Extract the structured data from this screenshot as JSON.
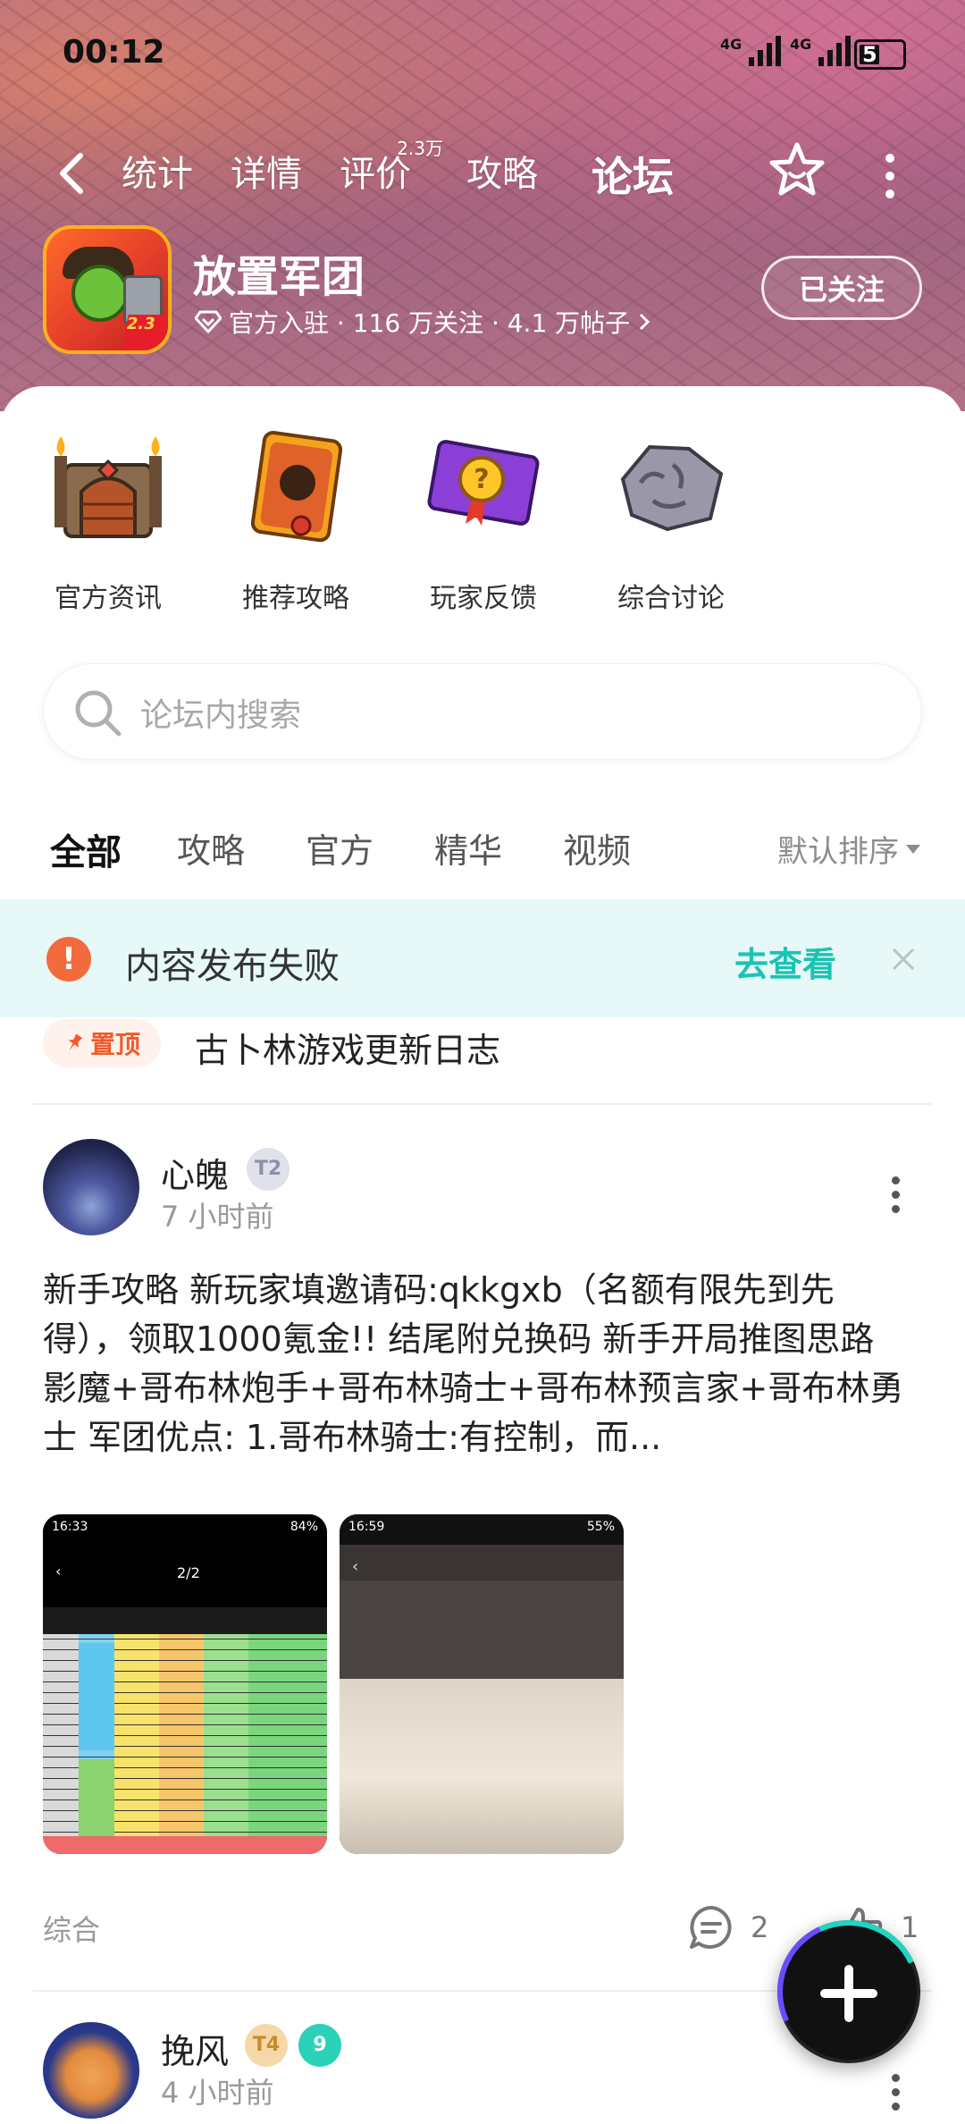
{
  "status": {
    "time": "00:12",
    "sig1": "4G",
    "sig2": "4G",
    "battery": "5"
  },
  "nav": {
    "tabs": [
      {
        "label": "统计"
      },
      {
        "label": "详情"
      },
      {
        "label": "评价",
        "sup": "2.3万"
      },
      {
        "label": "攻略"
      },
      {
        "label": "论坛"
      }
    ]
  },
  "game": {
    "name": "放置军团",
    "meta": "官方入驻 · 116 万关注 · 4.1 万帖子",
    "icon_badge": "2.3",
    "follow_label": "已关注"
  },
  "categories": [
    {
      "label": "官方资讯",
      "icon": "castle-gate-icon"
    },
    {
      "label": "推荐攻略",
      "icon": "guide-book-icon"
    },
    {
      "label": "玩家反馈",
      "icon": "feedback-book-icon"
    },
    {
      "label": "综合讨论",
      "icon": "stone-tablet-icon"
    }
  ],
  "search": {
    "placeholder": "论坛内搜索"
  },
  "filter": {
    "tabs": [
      "全部",
      "攻略",
      "官方",
      "精华",
      "视频"
    ],
    "sort": "默认排序"
  },
  "banner": {
    "message": "内容发布失败",
    "action": "去查看"
  },
  "pinned": {
    "badge": "置顶",
    "title": "古卜林游戏更新日志"
  },
  "post1": {
    "user": "心魄",
    "level": "T2",
    "time": "7 小时前",
    "body": "新手攻略  新玩家填邀请码:qkkgxb（名额有限先到先得），领取1000氪金!!  结尾附兑换码  新手开局推图思路  影魔+哥布林炮手+哥布林骑士+哥布林预言家+哥布林勇士  军团优点: 1.哥布林骑士:有控制，而...",
    "thumb1": {
      "time": "16:33",
      "title": "2/2",
      "battery": "84%"
    },
    "thumb2": {
      "time": "16:59",
      "battery": "55%"
    },
    "tag": "综合",
    "comments": "2",
    "likes": "1"
  },
  "post2": {
    "user": "挽风",
    "level": "T4",
    "badge": "9",
    "time": "4 小时前"
  }
}
